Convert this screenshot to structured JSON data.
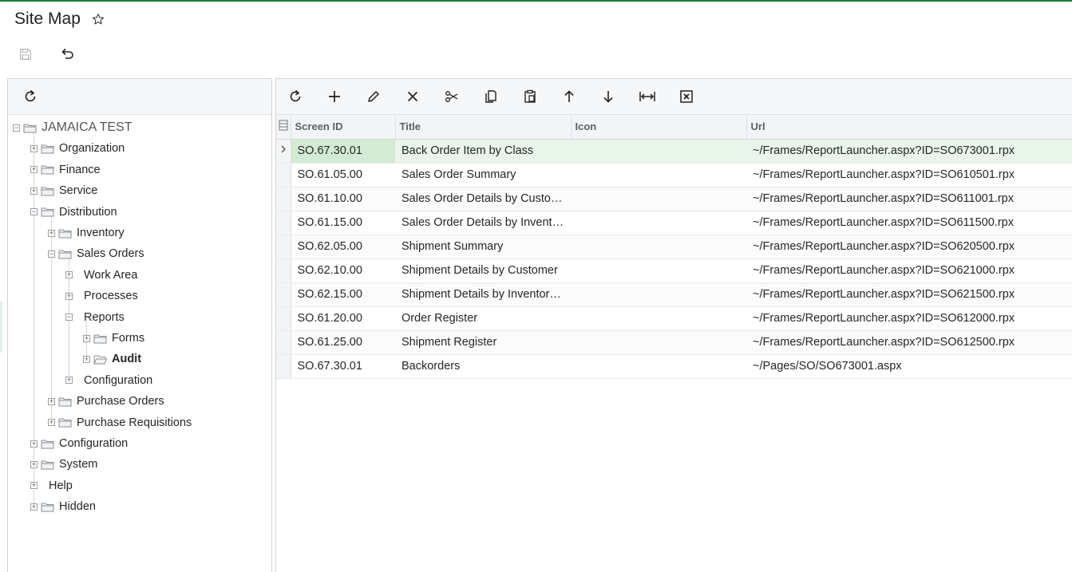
{
  "page": {
    "title": "Site Map"
  },
  "tree": {
    "nodes": [
      {
        "label": "JAMAICA TEST",
        "level": 0,
        "expanded": true,
        "bold": false
      },
      {
        "label": "Organization",
        "level": 1,
        "expanded": false
      },
      {
        "label": "Finance",
        "level": 1,
        "expanded": false
      },
      {
        "label": "Service",
        "level": 1,
        "expanded": false
      },
      {
        "label": "Distribution",
        "level": 1,
        "expanded": true
      },
      {
        "label": "Inventory",
        "level": 2,
        "expanded": false
      },
      {
        "label": "Sales Orders",
        "level": 2,
        "expanded": true
      },
      {
        "label": "Work Area",
        "level": 3,
        "expanded": false,
        "folder": false
      },
      {
        "label": "Processes",
        "level": 3,
        "expanded": false,
        "folder": false
      },
      {
        "label": "Reports",
        "level": 3,
        "expanded": true,
        "folder": false
      },
      {
        "label": "Forms",
        "level": 4,
        "expanded": false
      },
      {
        "label": "Audit",
        "level": 4,
        "expanded": false,
        "bold": true,
        "open_folder": true
      },
      {
        "label": "Configuration",
        "level": 3,
        "expanded": false,
        "folder": false
      },
      {
        "label": "Purchase Orders",
        "level": 2,
        "expanded": false
      },
      {
        "label": "Purchase Requisitions",
        "level": 2,
        "expanded": false
      },
      {
        "label": "Configuration",
        "level": 1,
        "expanded": false
      },
      {
        "label": "System",
        "level": 1,
        "expanded": false
      },
      {
        "label": "Help",
        "level": 1,
        "expanded": false,
        "folder": false
      },
      {
        "label": "Hidden",
        "level": 1,
        "expanded": false
      }
    ]
  },
  "grid": {
    "columns": [
      "Screen ID",
      "Title",
      "Icon",
      "Url"
    ],
    "rows": [
      {
        "screen_id": "SO.67.30.01",
        "title": "Back Order Item by Class",
        "icon": "",
        "url": "~/Frames/ReportLauncher.aspx?ID=SO673001.rpx"
      },
      {
        "screen_id": "SO.61.05.00",
        "title": "Sales Order Summary",
        "icon": "",
        "url": "~/Frames/ReportLauncher.aspx?ID=SO610501.rpx"
      },
      {
        "screen_id": "SO.61.10.00",
        "title": "Sales Order Details by Custo…",
        "icon": "",
        "url": "~/Frames/ReportLauncher.aspx?ID=SO611001.rpx"
      },
      {
        "screen_id": "SO.61.15.00",
        "title": "Sales Order Details by Invent…",
        "icon": "",
        "url": "~/Frames/ReportLauncher.aspx?ID=SO611500.rpx"
      },
      {
        "screen_id": "SO.62.05.00",
        "title": "Shipment Summary",
        "icon": "",
        "url": "~/Frames/ReportLauncher.aspx?ID=SO620500.rpx"
      },
      {
        "screen_id": "SO.62.10.00",
        "title": "Shipment Details by Customer",
        "icon": "",
        "url": "~/Frames/ReportLauncher.aspx?ID=SO621000.rpx"
      },
      {
        "screen_id": "SO.62.15.00",
        "title": "Shipment Details by Inventor…",
        "icon": "",
        "url": "~/Frames/ReportLauncher.aspx?ID=SO621500.rpx"
      },
      {
        "screen_id": "SO.61.20.00",
        "title": "Order Register",
        "icon": "",
        "url": "~/Frames/ReportLauncher.aspx?ID=SO612000.rpx"
      },
      {
        "screen_id": "SO.61.25.00",
        "title": "Shipment Register",
        "icon": "",
        "url": "~/Frames/ReportLauncher.aspx?ID=SO612500.rpx"
      },
      {
        "screen_id": "SO.67.30.01",
        "title": "Backorders",
        "icon": "",
        "url": "~/Pages/SO/SO673001.aspx"
      }
    ]
  },
  "colors": {
    "accent": "#1a7f37",
    "selected_row": "#e9f4ea",
    "selected_cell": "#d3ebd5"
  }
}
